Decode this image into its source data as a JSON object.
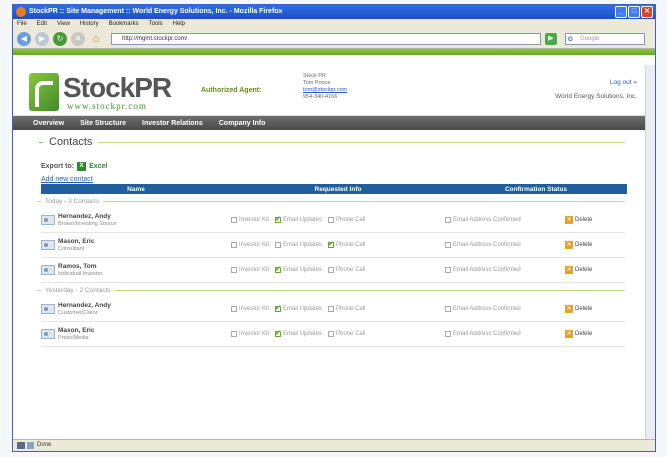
{
  "window": {
    "title": "StockPR :: Site Management :: World Energy Solutions, Inc. - Mozilla Firefox",
    "controls": [
      "_",
      "□",
      "✕"
    ]
  },
  "menubar": [
    "File",
    "Edit",
    "View",
    "History",
    "Bookmarks",
    "Tools",
    "Help"
  ],
  "toolbar": {
    "url": "http://mgmt.stockpr.com/",
    "search_placeholder": "Google",
    "search_engine": "G"
  },
  "header": {
    "logo_name": "StockPR",
    "logo_url": "www.stockpr.com",
    "agent_label": "Authorized Agent:",
    "agent_company": "Stock PR",
    "agent_name": "Tom Ponce",
    "agent_email": "tom@stockpr.com",
    "agent_phone": "954-340-4166",
    "logout": "Log out »",
    "company": "World Energy Solutions, Inc."
  },
  "nav": [
    "Overview",
    "Site Structure",
    "Investor Relations",
    "Company Info"
  ],
  "page": {
    "title": "Contacts",
    "export_label": "Export to:",
    "export_format": "Excel",
    "add_contact": "Add new contact"
  },
  "table": {
    "headers": [
      "Name",
      "Requested Info",
      "Confirmation Status"
    ],
    "option_labels": [
      "Investor Kit",
      "Email Updates",
      "Phone Call"
    ],
    "confirm_label": "Email Address Confirmed",
    "delete_label": "Delete"
  },
  "groups": [
    {
      "label": "Today - 3 Contacts",
      "contacts": [
        {
          "name": "Hernandez, Andy",
          "role": "Broker/Investing Source",
          "checked": [
            false,
            true,
            false
          ],
          "confirmed": false
        },
        {
          "name": "Mason, Eric",
          "role": "Consultant",
          "checked": [
            false,
            false,
            true
          ],
          "confirmed": false
        },
        {
          "name": "Ramos, Tom",
          "role": "Individual Investor",
          "checked": [
            false,
            true,
            false
          ],
          "confirmed": false
        }
      ]
    },
    {
      "label": "Yesterday - 2 Contacts",
      "contacts": [
        {
          "name": "Hernandez, Andy",
          "role": "Customer/Client",
          "checked": [
            false,
            true,
            false
          ],
          "confirmed": false
        },
        {
          "name": "Mason, Eric",
          "role": "Press/Media",
          "checked": [
            false,
            true,
            false
          ],
          "confirmed": false
        }
      ]
    }
  ],
  "status": "Done"
}
